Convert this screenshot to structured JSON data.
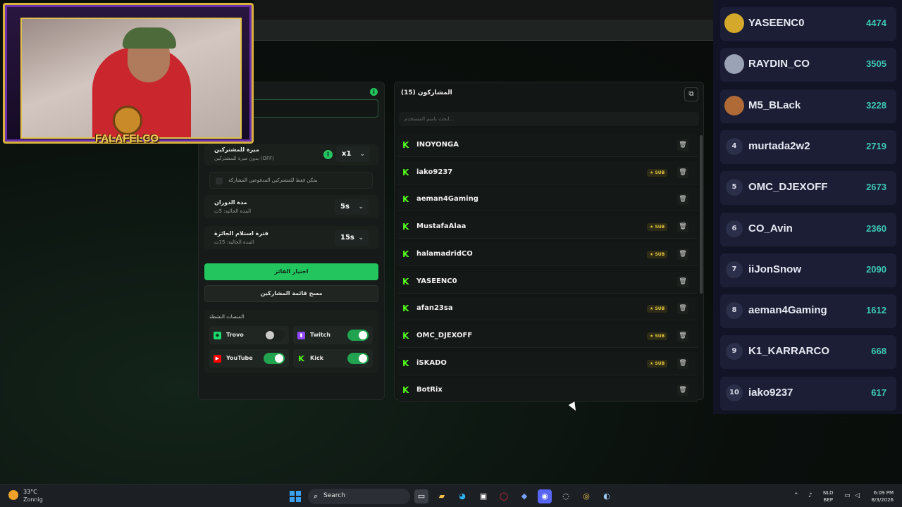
{
  "left_panel": {
    "bonus_title": "ميزة للمشتركين",
    "bonus_sub": "بدون ميزة للمشتركين (OFF)",
    "bonus_value": "x1",
    "subs_only_label": "يمكن فقط للمشتركين المدفوعين المشاركة",
    "spin_title": "مدة الدوران",
    "spin_sub": "المدة الحالية: 5ث",
    "spin_value": "5s",
    "claim_title": "فترة استلام الجائزة",
    "claim_sub": "المدة الحالية: 15ث",
    "claim_value": "15s",
    "pick_winner": "اختيار الفائز",
    "clear_list": "مسح قائمة المشاركين",
    "platforms_title": "المنصات النشطة",
    "platforms": [
      {
        "name": "Trovo",
        "on": false,
        "color": "#1bd96a"
      },
      {
        "name": "Twitch",
        "on": true,
        "color": "#9146ff"
      },
      {
        "name": "YouTube",
        "on": true,
        "color": "#ff0000"
      },
      {
        "name": "Kick",
        "on": true,
        "color": "#53fc18"
      }
    ]
  },
  "participants": {
    "title": "المشاركون (15)",
    "search_placeholder": "ابحث باسم المستخدم...",
    "sub_badge": "★ SUB",
    "rows": [
      {
        "name": "INOYONGA",
        "sub": false
      },
      {
        "name": "iako9237",
        "sub": true
      },
      {
        "name": "aeman4Gaming",
        "sub": false
      },
      {
        "name": "MustafaAlaa",
        "sub": true
      },
      {
        "name": "halamadridCO",
        "sub": true
      },
      {
        "name": "YASEENC0",
        "sub": false
      },
      {
        "name": "afan23sa",
        "sub": true
      },
      {
        "name": "OMC_DJEXOFF",
        "sub": true
      },
      {
        "name": "iSKADO",
        "sub": true
      },
      {
        "name": "BotRix",
        "sub": false
      }
    ]
  },
  "leaderboard": [
    {
      "rank": "1",
      "name": "YASEENC0",
      "points": "4474",
      "medal": "#d4a82a"
    },
    {
      "rank": "2",
      "name": "RAYDIN_CO",
      "points": "3505",
      "medal": "#9aa3b5"
    },
    {
      "rank": "3",
      "name": "M5_BLack",
      "points": "3228",
      "medal": "#b06a35"
    },
    {
      "rank": "4",
      "name": "murtada2w2",
      "points": "2719"
    },
    {
      "rank": "5",
      "name": "OMC_DJEXOFF",
      "points": "2673"
    },
    {
      "rank": "6",
      "name": "CO_Avin",
      "points": "2360"
    },
    {
      "rank": "7",
      "name": "iiJonSnow",
      "points": "2090"
    },
    {
      "rank": "8",
      "name": "aeman4Gaming",
      "points": "1612"
    },
    {
      "rank": "9",
      "name": "K1_KARRARCO",
      "points": "668"
    },
    {
      "rank": "10",
      "name": "iako9237",
      "points": "617"
    }
  ],
  "webcam": {
    "logo_text": "FALAFELCO"
  },
  "taskbar": {
    "temp": "33°C",
    "condition": "Zonnig",
    "search": "Search",
    "lang_1": "NLD",
    "lang_2": "BEP",
    "time": "6:09 PM",
    "date": "8/3/2026"
  }
}
